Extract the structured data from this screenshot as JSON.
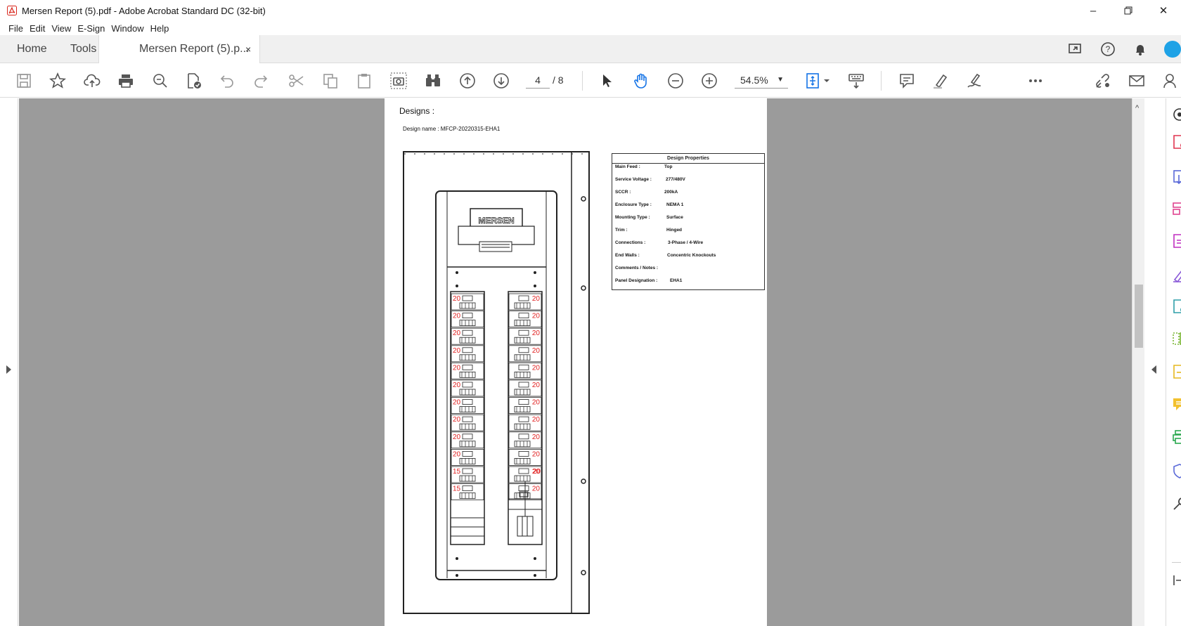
{
  "window": {
    "title": "Mersen Report (5).pdf - Adobe Acrobat Standard DC (32-bit)",
    "controls": [
      "minimize",
      "restore",
      "close"
    ]
  },
  "menu": [
    "File",
    "Edit",
    "View",
    "E-Sign",
    "Window",
    "Help"
  ],
  "tabs": {
    "home": "Home",
    "tools": "Tools",
    "document": "Mersen Report (5).p...",
    "close_glyph": "×"
  },
  "toolbar": {
    "page_current": "4",
    "page_total": "/ 8",
    "zoom": "54.5%",
    "icons": [
      "save-icon",
      "bookmark-star-icon",
      "upload-cloud-icon",
      "print-icon",
      "zoom-search-icon",
      "file-check-icon",
      "undo-icon",
      "redo-icon",
      "cut-icon",
      "copy-icon",
      "paste-icon",
      "snapshot-icon",
      "binoculars-icon",
      "page-up-icon",
      "page-down-icon",
      "select-arrow-icon",
      "hand-tool-icon",
      "zoom-out-icon",
      "zoom-in-icon",
      "fit-page-icon",
      "keyboard-scroll-icon",
      "comment-icon",
      "highlight-icon",
      "sign-icon",
      "more-icon",
      "share-link-icon",
      "email-icon",
      "user-add-icon"
    ]
  },
  "document": {
    "heading": "Designs :",
    "design_name": "Design name : MFCP-20220315-EHA1",
    "properties": {
      "title": "Design Properties",
      "rows": [
        {
          "label": "Main Feed :",
          "value": "Top"
        },
        {
          "label": "Service Voltage :",
          "value": "277/480V"
        },
        {
          "label": "SCCR :",
          "value": "200kA"
        },
        {
          "label": "Enclosure Type :",
          "value": "NEMA 1"
        },
        {
          "label": "Mounting Type :",
          "value": "Surface"
        },
        {
          "label": "Trim :",
          "value": "Hinged"
        },
        {
          "label": "Connections :",
          "value": "3-Phase / 4-Wire"
        },
        {
          "label": "End Walls :",
          "value": "Concentric Knockouts"
        },
        {
          "label": "Comments / Notes :",
          "value": ""
        },
        {
          "label": "Panel Designation :",
          "value": "EHA1"
        }
      ]
    },
    "panel": {
      "logo": "MERSEN",
      "left_breakers": [
        "20",
        "20",
        "20",
        "20",
        "20",
        "20",
        "20",
        "20",
        "20",
        "20",
        "15",
        "15"
      ],
      "right_breakers": [
        "20",
        "20",
        "20",
        "20",
        "20",
        "20",
        "20",
        "20",
        "20",
        "20",
        "20",
        "20"
      ],
      "right_last": "20",
      "breaker_color": "#e02020"
    }
  },
  "colors": {
    "acrobat_red": "#d9261c",
    "accent_blue": "#1473e6",
    "canvas_gray": "#9b9b9b"
  }
}
